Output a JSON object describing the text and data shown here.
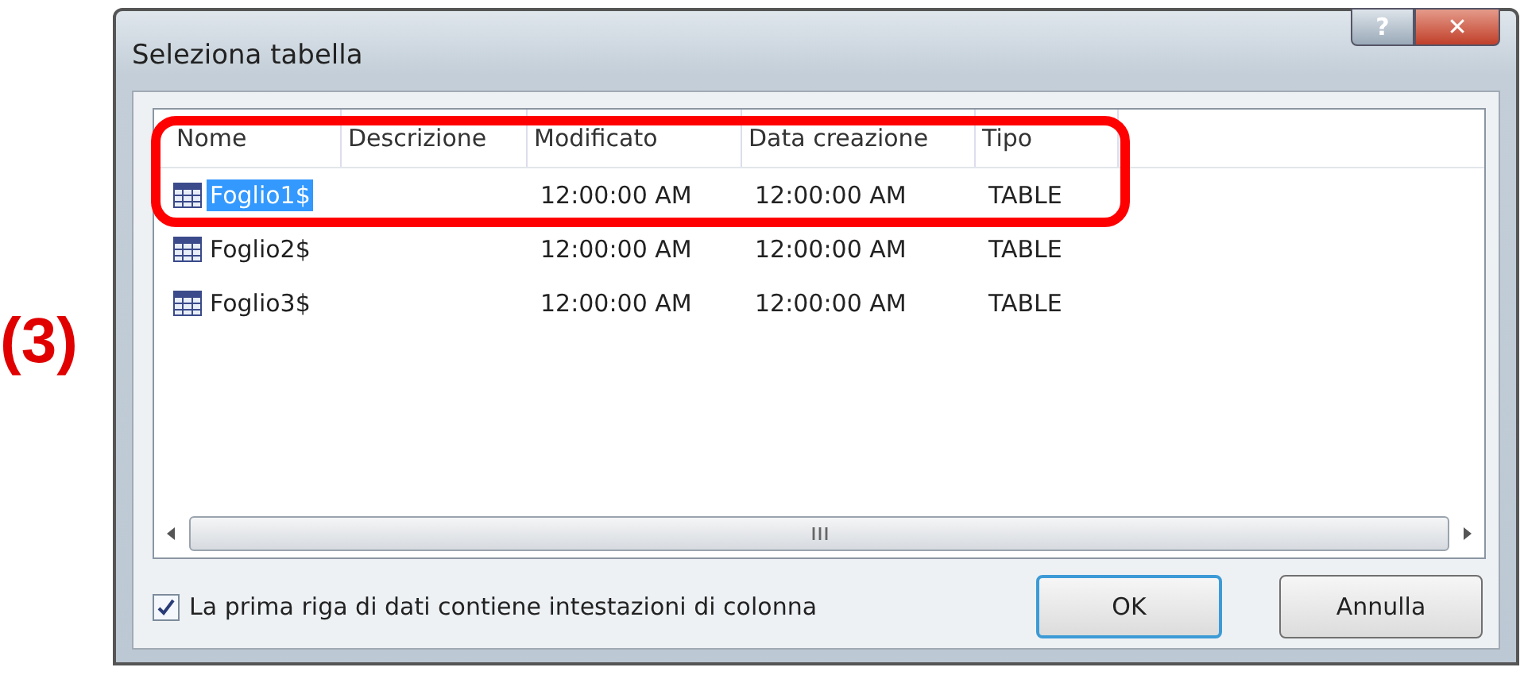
{
  "annotation": {
    "label": "(3)"
  },
  "window": {
    "title": "Seleziona tabella",
    "help_button": "?",
    "close_button": "✕"
  },
  "table": {
    "columns": [
      "Nome",
      "Descrizione",
      "Modificato",
      "Data creazione",
      "Tipo"
    ],
    "rows": [
      {
        "selected": true,
        "cells": [
          "Foglio1$",
          "",
          "12:00:00 AM",
          "12:00:00 AM",
          "TABLE"
        ]
      },
      {
        "selected": false,
        "cells": [
          "Foglio2$",
          "",
          "12:00:00 AM",
          "12:00:00 AM",
          "TABLE"
        ]
      },
      {
        "selected": false,
        "cells": [
          "Foglio3$",
          "",
          "12:00:00 AM",
          "12:00:00 AM",
          "TABLE"
        ]
      }
    ]
  },
  "header_checkbox": {
    "label": "La prima riga di dati contiene intestazioni di colonna",
    "checked": true
  },
  "buttons": [
    {
      "label": "OK",
      "default": true
    },
    {
      "label": "Annulla",
      "default": false
    }
  ]
}
